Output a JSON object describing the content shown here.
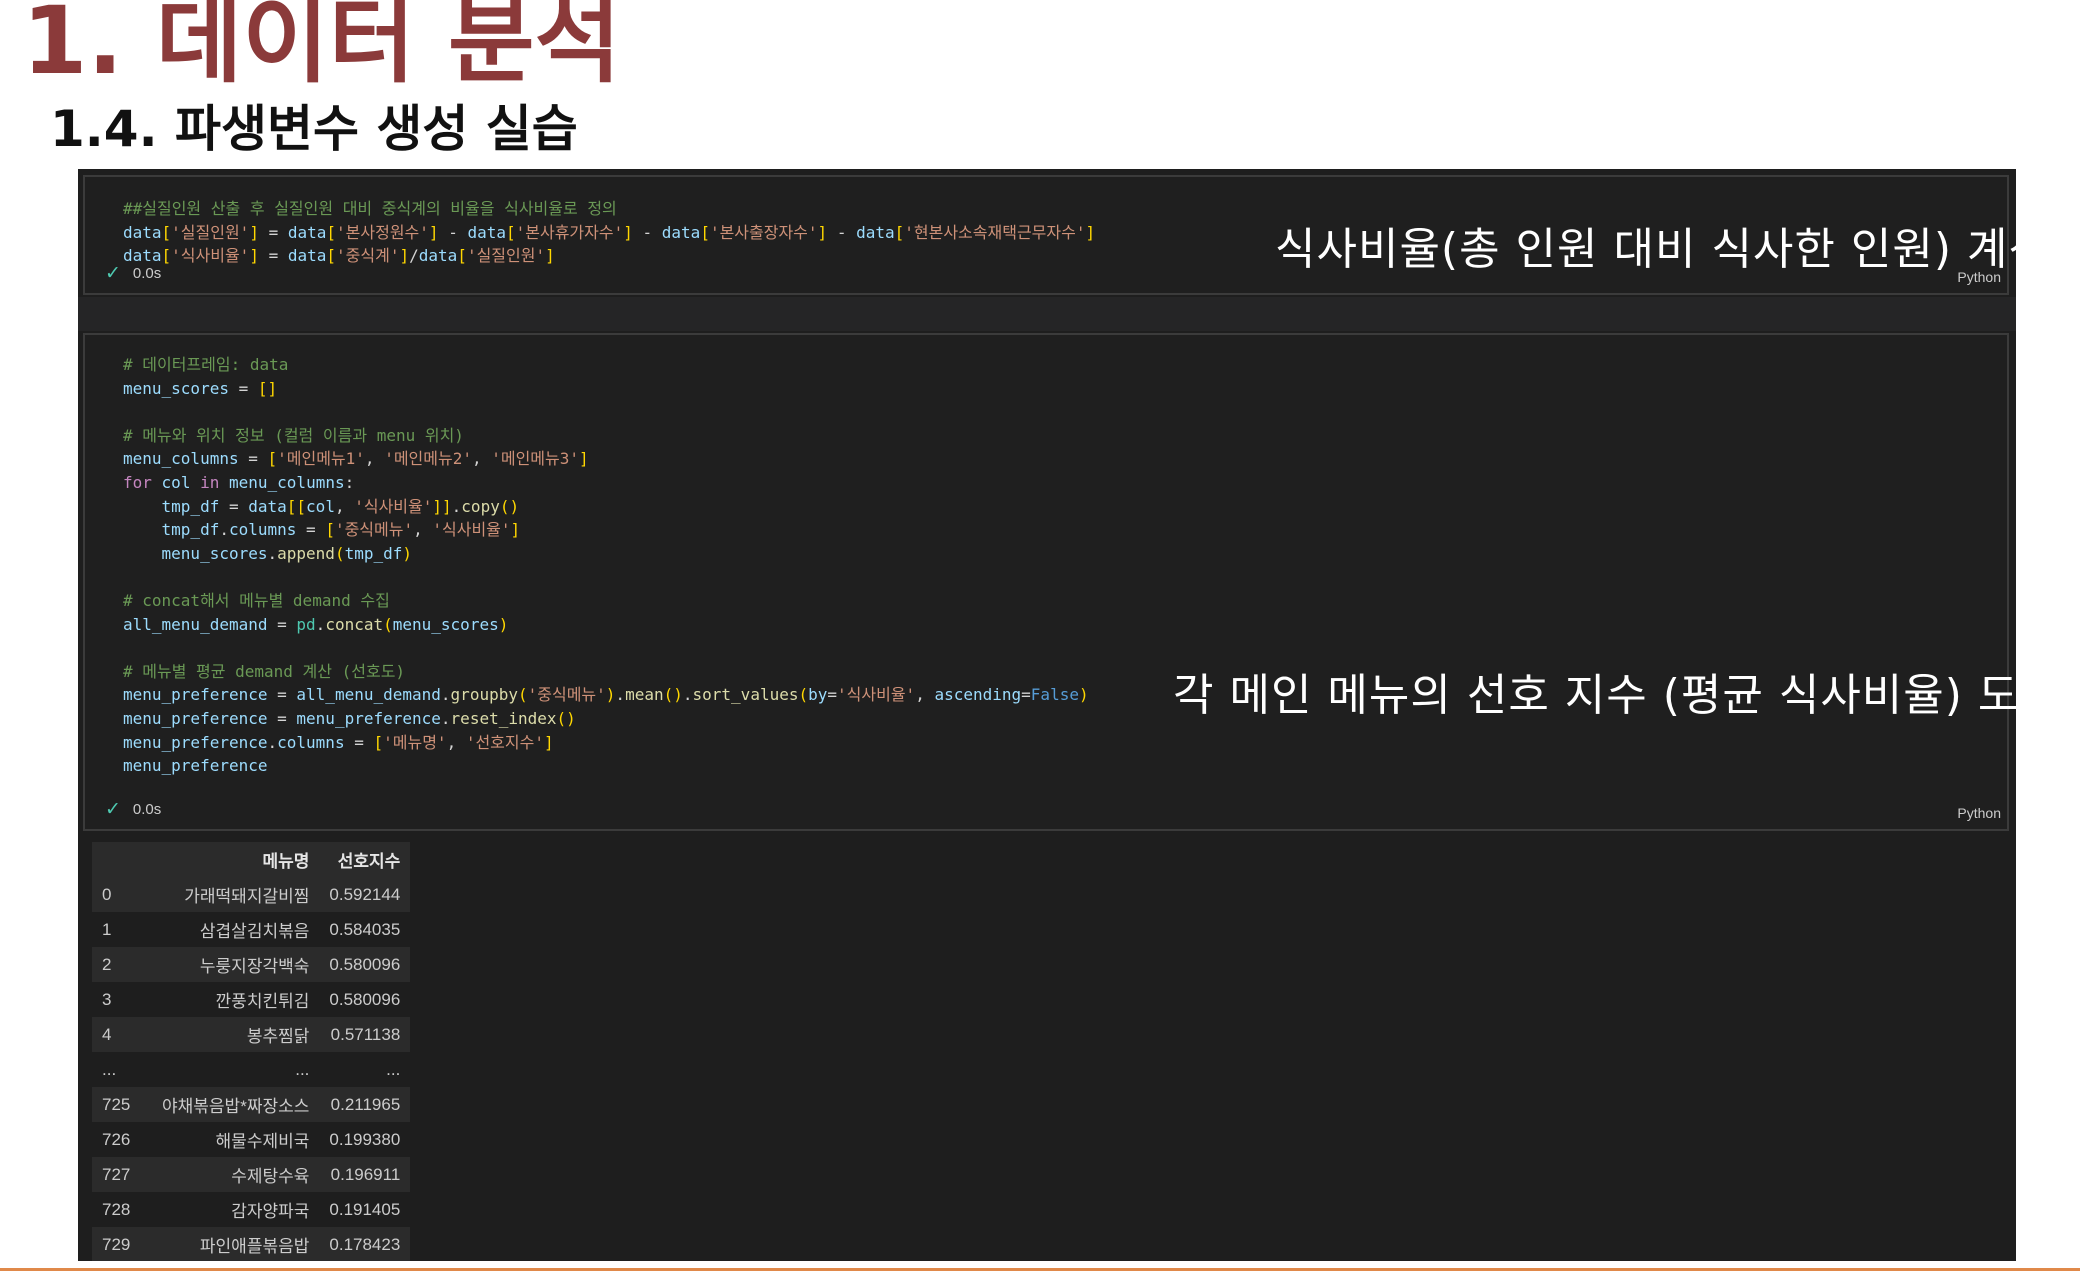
{
  "slide": {
    "title": "1. 데이터 분석",
    "subtitle": "1.4. 파생변수 생성 실습"
  },
  "cell1": {
    "code_lines": [
      "##실질인원 산출 후 실질인원 대비 중식계의 비율을 식사비율로 정의",
      "data['실질인원'] = data['본사정원수'] - data['본사휴가자수'] - data['본사출장자수'] - data['현본사소속재택근무자수']",
      "data['식사비율'] = data['중식계']/data['실질인원']"
    ],
    "time": "0.0s",
    "language": "Python",
    "annotation": "식사비율(총 인원 대비 식사한 인원) 계산"
  },
  "cell2": {
    "code_lines": [
      "# 데이터프레임: data",
      "menu_scores = []",
      "",
      "# 메뉴와 위치 정보 (컬럼 이름과 menu 위치)",
      "menu_columns = ['메인메뉴1', '메인메뉴2', '메인메뉴3']",
      "for col in menu_columns:",
      "    tmp_df = data[[col, '식사비율']].copy()",
      "    tmp_df.columns = ['중식메뉴', '식사비율']",
      "    menu_scores.append(tmp_df)",
      "",
      "# concat해서 메뉴별 demand 수집",
      "all_menu_demand = pd.concat(menu_scores)",
      "",
      "# 메뉴별 평균 demand 계산 (선호도)",
      "menu_preference = all_menu_demand.groupby('중식메뉴').mean().sort_values(by='식사비율', ascending=False)",
      "menu_preference = menu_preference.reset_index()",
      "menu_preference.columns = ['메뉴명', '선호지수']",
      "menu_preference"
    ],
    "time": "0.0s",
    "language": "Python",
    "annotation": "각 메인 메뉴의 선호 지수 (평균 식사비율) 도출"
  },
  "output_table": {
    "columns": [
      "",
      "메뉴명",
      "선호지수"
    ],
    "rows": [
      [
        "0",
        "가래떡돼지갈비찜",
        "0.592144"
      ],
      [
        "1",
        "삼겹살김치볶음",
        "0.584035"
      ],
      [
        "2",
        "누룽지장각백숙",
        "0.580096"
      ],
      [
        "3",
        "깐풍치킨튀김",
        "0.580096"
      ],
      [
        "4",
        "봉추찜닭",
        "0.571138"
      ],
      [
        "...",
        "...",
        "..."
      ],
      [
        "725",
        "야채볶음밥*짜장소스",
        "0.211965"
      ],
      [
        "726",
        "해물수제비국",
        "0.199380"
      ],
      [
        "727",
        "수제탕수육",
        "0.196911"
      ],
      [
        "728",
        "감자양파국",
        "0.191405"
      ],
      [
        "729",
        "파인애플볶음밥",
        "0.178423"
      ]
    ]
  },
  "colors": {
    "title": "#8b3a3a",
    "notebook_bg": "#1e1e1e",
    "comment": "#6a9955",
    "string": "#ce9178",
    "variable": "#9cdcfe",
    "function": "#dcdcaa",
    "keyword": "#c586c0",
    "check": "#4ec9b0",
    "accent_rule": "#e0894a"
  },
  "icons": {
    "status": "check-icon"
  }
}
